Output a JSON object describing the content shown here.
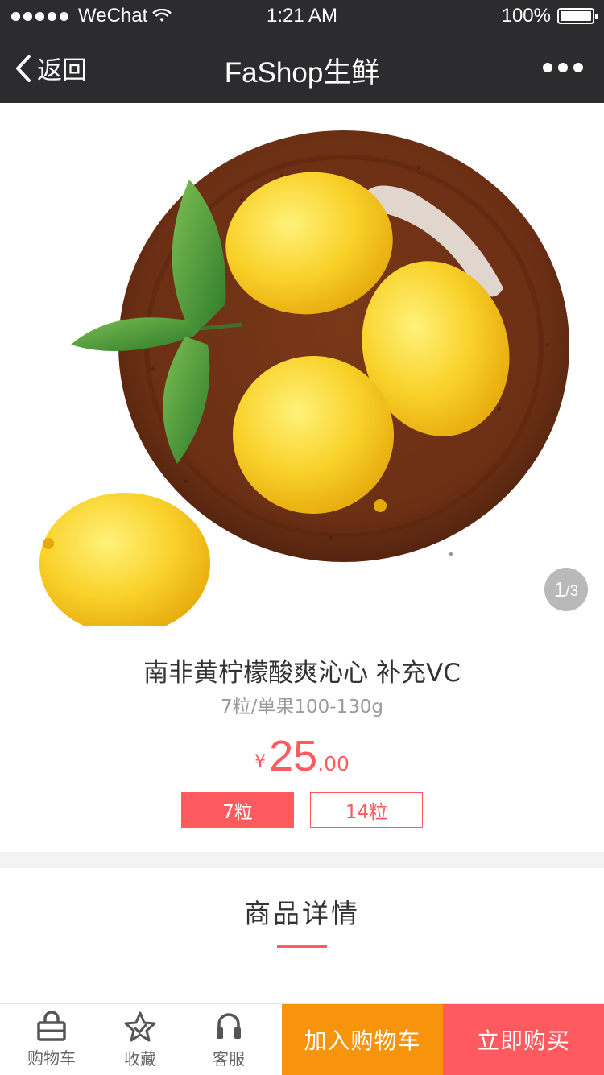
{
  "status_bar": {
    "carrier": "WeChat",
    "time": "1:21 AM",
    "battery": "100%",
    "battery_level": 1.0,
    "signal_dots": 5
  },
  "nav": {
    "back_label": "返回",
    "title": "FaShop生鲜",
    "more_icon": "more-dots-icon"
  },
  "gallery": {
    "current": "1",
    "total": "/3"
  },
  "product": {
    "title": "南非黄柠檬酸爽沁心 补充VC",
    "subtitle": "7粒/单果100-130g",
    "currency": "¥",
    "price_int": "25",
    "price_dec": ".00",
    "options": [
      {
        "label": "7粒",
        "selected": true
      },
      {
        "label": "14粒",
        "selected": false
      }
    ]
  },
  "detail": {
    "title": "商品详情"
  },
  "bottom_bar": {
    "cart_label": "购物车",
    "favorite_label": "收藏",
    "service_label": "客服",
    "add_to_cart_label": "加入购物车",
    "buy_now_label": "立即购买"
  },
  "colors": {
    "accent": "#ff5a5f",
    "cart_button": "#f7940c",
    "nav_bg": "#2c2c2e"
  }
}
